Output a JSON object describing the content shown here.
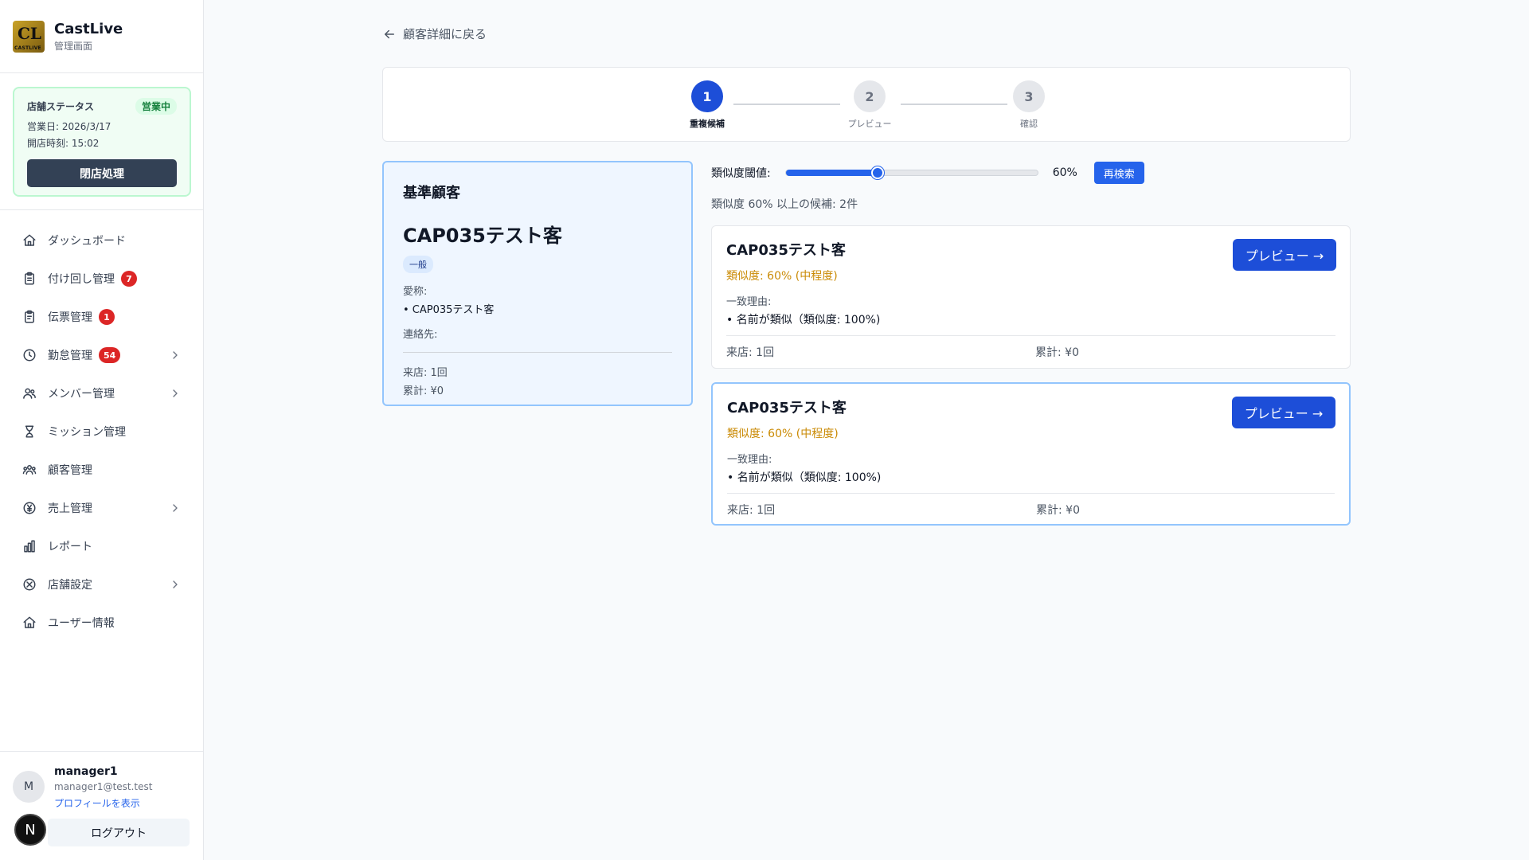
{
  "brand": {
    "name": "CastLive",
    "subtitle": "管理画面",
    "logo_letters": "CL",
    "logo_text": "CASTLIVE"
  },
  "store_status": {
    "label": "店舗ステータス",
    "badge": "営業中",
    "business_day": "営業日: 2026/3/17",
    "open_time": "開店時刻: 15:02",
    "close_button": "閉店処理"
  },
  "nav": [
    {
      "label": "ダッシュボード",
      "icon": "home-icon"
    },
    {
      "label": "付け回し管理",
      "icon": "clipboard-icon",
      "badge": "7"
    },
    {
      "label": "伝票管理",
      "icon": "receipt-icon",
      "badge": "1"
    },
    {
      "label": "勤怠管理",
      "icon": "clock-icon",
      "badge": "54",
      "chevron": true
    },
    {
      "label": "メンバー管理",
      "icon": "users-icon",
      "chevron": true
    },
    {
      "label": "ミッション管理",
      "icon": "trophy-icon"
    },
    {
      "label": "顧客管理",
      "icon": "customers-icon"
    },
    {
      "label": "売上管理",
      "icon": "yen-icon",
      "chevron": true
    },
    {
      "label": "レポート",
      "icon": "chart-icon"
    },
    {
      "label": "店舗設定",
      "icon": "settings-icon",
      "chevron": true
    },
    {
      "label": "ユーザー情報",
      "icon": "user-home-icon"
    }
  ],
  "user": {
    "initial": "M",
    "name": "manager1",
    "email": "manager1@test.test",
    "profile_link": "プロフィールを表示",
    "logout": "ログアウト",
    "n_badge": "N"
  },
  "back_link": "顧客詳細に戻る",
  "steps": [
    {
      "num": "1",
      "label": "重複候補",
      "active": true
    },
    {
      "num": "2",
      "label": "プレビュー",
      "active": false
    },
    {
      "num": "3",
      "label": "確認",
      "active": false
    }
  ],
  "base": {
    "title": "基準顧客",
    "name": "CAP035テスト客",
    "tag": "一般",
    "nickname_label": "愛称:",
    "nickname_value": "• CAP035テスト客",
    "contact_label": "連絡先:",
    "visits": "来店: 1回",
    "total": "累計: ¥0"
  },
  "threshold": {
    "label": "類似度閾値:",
    "value": "60%",
    "fraction": 0.6,
    "button": "再検索"
  },
  "summary": "類似度 60% 以上の候補: 2件",
  "candidates": [
    {
      "name": "CAP035テスト客",
      "similarity": "類似度: 60% (中程度)",
      "reason_label": "一致理由:",
      "reason": "• 名前が類似（類似度: 100%)",
      "visits": "来店: 1回",
      "total": "累計: ¥0",
      "button": "プレビュー →"
    },
    {
      "name": "CAP035テスト客",
      "similarity": "類似度: 60% (中程度)",
      "reason_label": "一致理由:",
      "reason": "• 名前が類似（類似度: 100%)",
      "visits": "来店: 1回",
      "total": "累計: ¥0",
      "button": "プレビュー →"
    }
  ]
}
